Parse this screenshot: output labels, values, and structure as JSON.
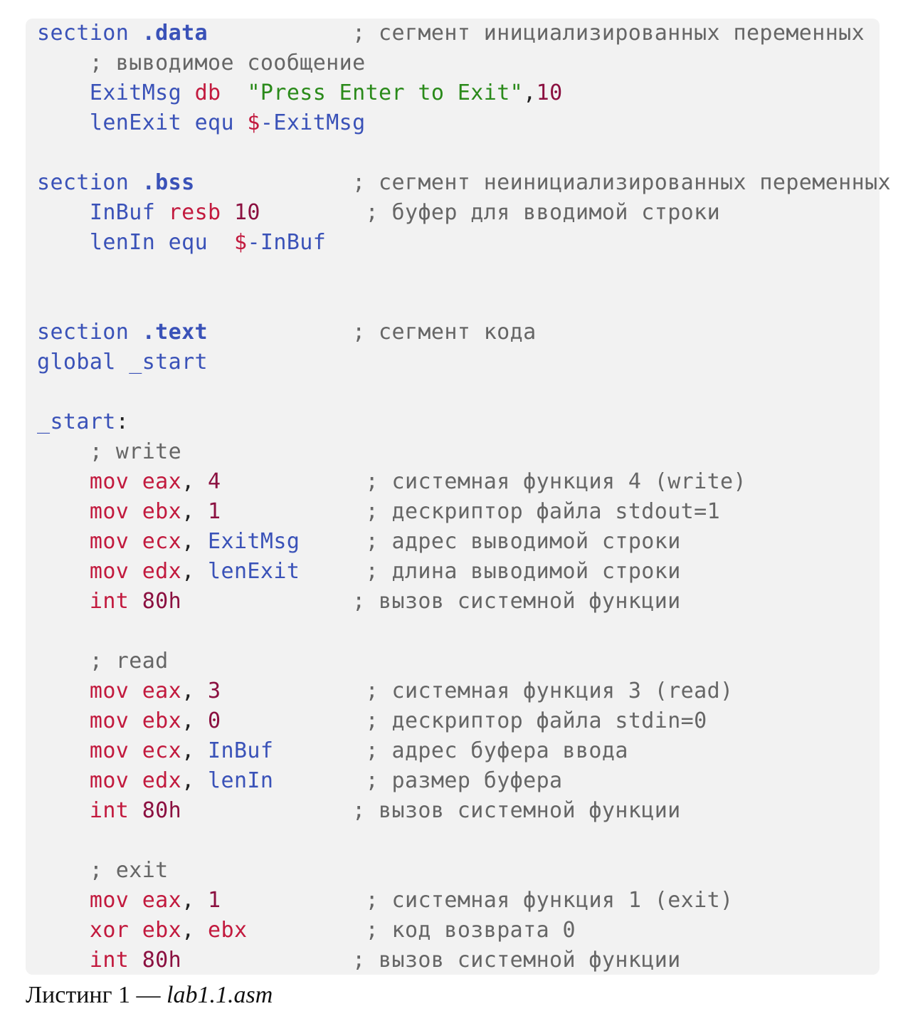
{
  "listing": {
    "lines": [
      [
        [
          "section ",
          "directive"
        ],
        [
          ".data",
          "dir-bold"
        ],
        [
          "           ; сегмент инициализированных переменных",
          "comment"
        ]
      ],
      [
        [
          "    ; выводимое сообщение",
          "comment"
        ]
      ],
      [
        [
          "    ",
          "punct"
        ],
        [
          "ExitMsg",
          "ident"
        ],
        [
          " ",
          "punct"
        ],
        [
          "db",
          "instr"
        ],
        [
          "  ",
          "punct"
        ],
        [
          "\"Press Enter to Exit\"",
          "str"
        ],
        [
          ",",
          "punct"
        ],
        [
          "10",
          "num"
        ]
      ],
      [
        [
          "    ",
          "punct"
        ],
        [
          "lenExit",
          "ident"
        ],
        [
          " ",
          "punct"
        ],
        [
          "equ",
          "ident"
        ],
        [
          " ",
          "punct"
        ],
        [
          "$",
          "reg"
        ],
        [
          "-ExitMsg",
          "ident"
        ]
      ],
      [],
      [
        [
          "section ",
          "directive"
        ],
        [
          ".bss",
          "dir-bold"
        ],
        [
          "            ; сегмент неинициализированных переменных",
          "comment"
        ]
      ],
      [
        [
          "    ",
          "punct"
        ],
        [
          "InBuf",
          "ident"
        ],
        [
          " ",
          "punct"
        ],
        [
          "resb",
          "instr"
        ],
        [
          " ",
          "punct"
        ],
        [
          "10",
          "num"
        ],
        [
          "        ; буфер для вводимой строки",
          "comment"
        ]
      ],
      [
        [
          "    ",
          "punct"
        ],
        [
          "lenIn",
          "ident"
        ],
        [
          " ",
          "punct"
        ],
        [
          "equ",
          "ident"
        ],
        [
          "  ",
          "punct"
        ],
        [
          "$",
          "reg"
        ],
        [
          "-InBuf",
          "ident"
        ]
      ],
      [],
      [],
      [
        [
          "section ",
          "directive"
        ],
        [
          ".text",
          "dir-bold"
        ],
        [
          "           ; сегмент кода",
          "comment"
        ]
      ],
      [
        [
          "global _start",
          "directive"
        ]
      ],
      [],
      [
        [
          "_start",
          "directive"
        ],
        [
          ":",
          "punct"
        ]
      ],
      [
        [
          "    ; write",
          "comment"
        ]
      ],
      [
        [
          "    ",
          "punct"
        ],
        [
          "mov",
          "instr"
        ],
        [
          " ",
          "punct"
        ],
        [
          "eax",
          "reg"
        ],
        [
          ", ",
          "punct"
        ],
        [
          "4",
          "num"
        ],
        [
          "           ; системная функция 4 (write)",
          "comment"
        ]
      ],
      [
        [
          "    ",
          "punct"
        ],
        [
          "mov",
          "instr"
        ],
        [
          " ",
          "punct"
        ],
        [
          "ebx",
          "reg"
        ],
        [
          ", ",
          "punct"
        ],
        [
          "1",
          "num"
        ],
        [
          "           ; дескриптор файла stdout=1",
          "comment"
        ]
      ],
      [
        [
          "    ",
          "punct"
        ],
        [
          "mov",
          "instr"
        ],
        [
          " ",
          "punct"
        ],
        [
          "ecx",
          "reg"
        ],
        [
          ", ",
          "punct"
        ],
        [
          "ExitMsg",
          "ident"
        ],
        [
          "     ; адрес выводимой строки",
          "comment"
        ]
      ],
      [
        [
          "    ",
          "punct"
        ],
        [
          "mov",
          "instr"
        ],
        [
          " ",
          "punct"
        ],
        [
          "edx",
          "reg"
        ],
        [
          ", ",
          "punct"
        ],
        [
          "lenExit",
          "ident"
        ],
        [
          "     ; длина выводимой строки",
          "comment"
        ]
      ],
      [
        [
          "    ",
          "punct"
        ],
        [
          "int",
          "instr"
        ],
        [
          " ",
          "punct"
        ],
        [
          "80h",
          "num"
        ],
        [
          "             ; вызов системной функции",
          "comment"
        ]
      ],
      [],
      [
        [
          "    ; read",
          "comment"
        ]
      ],
      [
        [
          "    ",
          "punct"
        ],
        [
          "mov",
          "instr"
        ],
        [
          " ",
          "punct"
        ],
        [
          "eax",
          "reg"
        ],
        [
          ", ",
          "punct"
        ],
        [
          "3",
          "num"
        ],
        [
          "           ; системная функция 3 (read)",
          "comment"
        ]
      ],
      [
        [
          "    ",
          "punct"
        ],
        [
          "mov",
          "instr"
        ],
        [
          " ",
          "punct"
        ],
        [
          "ebx",
          "reg"
        ],
        [
          ", ",
          "punct"
        ],
        [
          "0",
          "num"
        ],
        [
          "           ; дескриптор файла stdin=0",
          "comment"
        ]
      ],
      [
        [
          "    ",
          "punct"
        ],
        [
          "mov",
          "instr"
        ],
        [
          " ",
          "punct"
        ],
        [
          "ecx",
          "reg"
        ],
        [
          ", ",
          "punct"
        ],
        [
          "InBuf",
          "ident"
        ],
        [
          "       ; адрес буфера ввода",
          "comment"
        ]
      ],
      [
        [
          "    ",
          "punct"
        ],
        [
          "mov",
          "instr"
        ],
        [
          " ",
          "punct"
        ],
        [
          "edx",
          "reg"
        ],
        [
          ", ",
          "punct"
        ],
        [
          "lenIn",
          "ident"
        ],
        [
          "       ; размер буфера",
          "comment"
        ]
      ],
      [
        [
          "    ",
          "punct"
        ],
        [
          "int",
          "instr"
        ],
        [
          " ",
          "punct"
        ],
        [
          "80h",
          "num"
        ],
        [
          "             ; вызов системной функции",
          "comment"
        ]
      ],
      [],
      [
        [
          "    ; exit",
          "comment"
        ]
      ],
      [
        [
          "    ",
          "punct"
        ],
        [
          "mov",
          "instr"
        ],
        [
          " ",
          "punct"
        ],
        [
          "eax",
          "reg"
        ],
        [
          ", ",
          "punct"
        ],
        [
          "1",
          "num"
        ],
        [
          "           ; системная функция 1 (exit)",
          "comment"
        ]
      ],
      [
        [
          "    ",
          "punct"
        ],
        [
          "xor",
          "instr"
        ],
        [
          " ",
          "punct"
        ],
        [
          "ebx",
          "reg"
        ],
        [
          ", ",
          "punct"
        ],
        [
          "ebx",
          "reg"
        ],
        [
          "         ; код возврата 0",
          "comment"
        ]
      ],
      [
        [
          "    ",
          "punct"
        ],
        [
          "int",
          "instr"
        ],
        [
          " ",
          "punct"
        ],
        [
          "80h",
          "num"
        ],
        [
          "             ; вызов системной функции",
          "comment"
        ]
      ]
    ]
  },
  "caption": {
    "prefix": "Листинг 1 — ",
    "filename": "lab1.1.asm"
  }
}
